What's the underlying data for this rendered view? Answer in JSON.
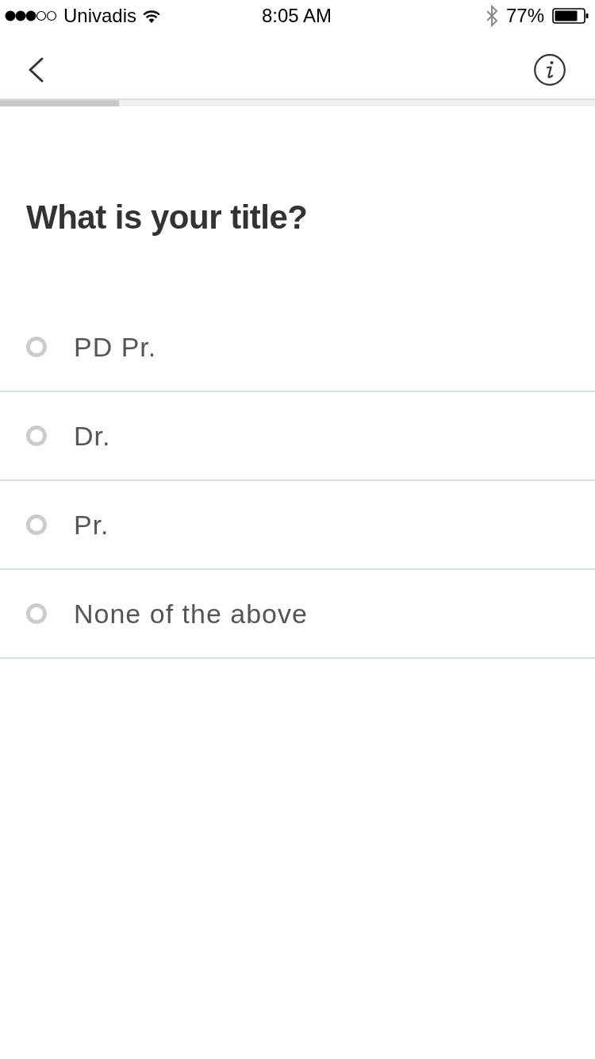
{
  "status_bar": {
    "carrier": "Univadis",
    "time": "8:05 AM",
    "battery": "77%"
  },
  "progress": {
    "level": 0.2
  },
  "question": "What is your title?",
  "options": [
    {
      "label": "PD Pr.",
      "selected": false
    },
    {
      "label": "Dr.",
      "selected": false
    },
    {
      "label": "Pr.",
      "selected": false
    },
    {
      "label": "None of the above",
      "selected": false
    }
  ]
}
